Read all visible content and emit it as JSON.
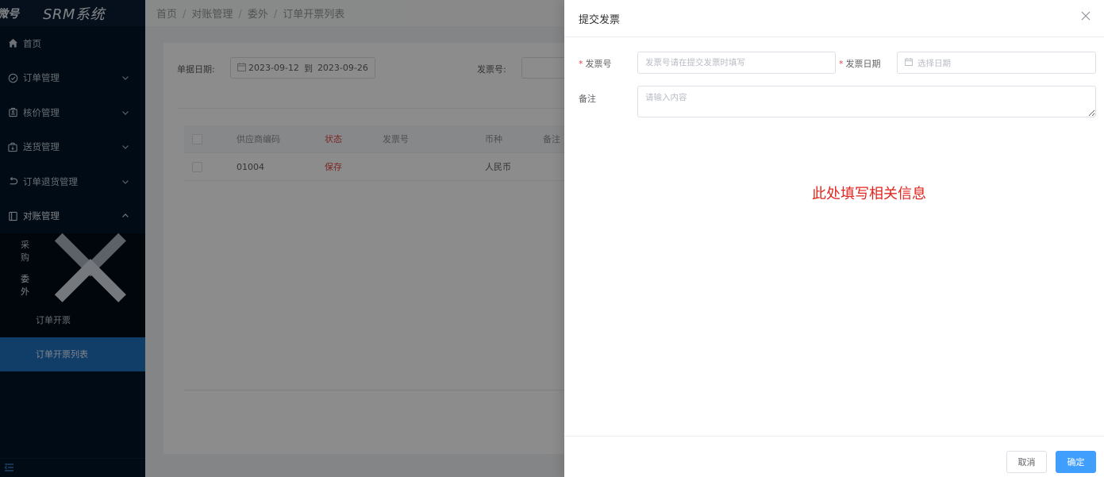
{
  "sidebar": {
    "brand_left": "微号",
    "brand_title": "SRM系统",
    "items": [
      {
        "label": "首页",
        "icon": "home-icon"
      },
      {
        "label": "订单管理",
        "icon": "check-circle-icon"
      },
      {
        "label": "核价管理",
        "icon": "price-tag-icon"
      },
      {
        "label": "送货管理",
        "icon": "package-icon"
      },
      {
        "label": "订单退货管理",
        "icon": "return-arrow-icon"
      },
      {
        "label": "对账管理",
        "icon": "book-icon"
      }
    ],
    "sub_items": [
      {
        "label": "采购"
      },
      {
        "label": "委外"
      },
      {
        "label": "订单开票"
      },
      {
        "label": "订单开票列表"
      }
    ]
  },
  "breadcrumb": [
    "首页",
    "对账管理",
    "委外",
    "订单开票列表"
  ],
  "filters": {
    "date_label": "单据日期:",
    "date_start": "2023-09-12",
    "date_sep": "到",
    "date_end": "2023-09-26",
    "invoice_label": "发票号:"
  },
  "table": {
    "columns": [
      "供应商编码",
      "状态",
      "发票号",
      "币种",
      "备注"
    ],
    "rows": [
      {
        "supplier_code": "01004",
        "status": "保存",
        "invoice_no": "",
        "currency": "人民币",
        "remark": ""
      }
    ]
  },
  "drawer": {
    "title": "提交发票",
    "invoice_label": "发票号",
    "invoice_placeholder": "发票号请在提交发票时填写",
    "date_label": "发票日期",
    "date_placeholder": "选择日期",
    "remark_label": "备注",
    "remark_placeholder": "请输入内容",
    "annotation": "此处填写相关信息",
    "cancel_label": "取消",
    "ok_label": "确定"
  },
  "colors": {
    "sidebar_bg": "#001529",
    "active_bg": "#1f6fbf",
    "primary": "#409eff",
    "required": "#e34848",
    "annotation": "#e0251f"
  }
}
